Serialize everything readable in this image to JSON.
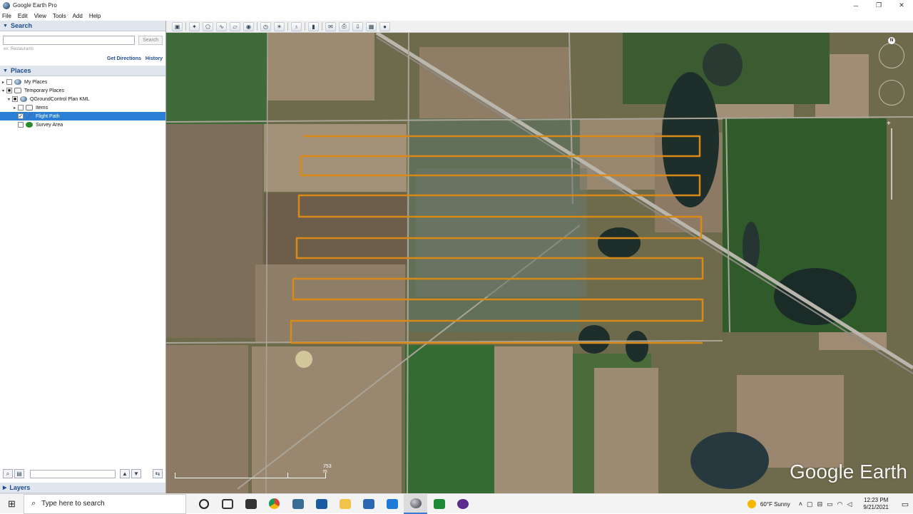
{
  "window": {
    "title": "Google Earth Pro",
    "controls": [
      "minimize-icon",
      "restore-icon",
      "close-icon"
    ]
  },
  "menu": [
    "File",
    "Edit",
    "View",
    "Tools",
    "Add",
    "Help"
  ],
  "search_panel": {
    "header": "Search",
    "input_value": "",
    "button": "Search",
    "hint": "ex: Restaurants",
    "get_directions": "Get Directions",
    "history": "History"
  },
  "places_panel": {
    "header": "Places",
    "items": [
      {
        "label": "My Places",
        "level": 0,
        "expander": "▸",
        "checked": false,
        "icon": "globe-icon"
      },
      {
        "label": "Temporary Places",
        "level": 0,
        "expander": "▾",
        "checked": true,
        "icon": "folder-icon"
      },
      {
        "label": "QGroundControl Plan KML",
        "level": 1,
        "expander": "▾",
        "checked": true,
        "icon": "globe-icon"
      },
      {
        "label": "Items",
        "level": 2,
        "expander": "▸",
        "checked": false,
        "icon": "folder-icon"
      },
      {
        "label": "Flight Path",
        "level": 2,
        "expander": "",
        "checked": true,
        "icon": "path-icon",
        "selected": true
      },
      {
        "label": "Survey Area",
        "level": 2,
        "expander": "",
        "checked": false,
        "icon": "polygon-icon"
      }
    ]
  },
  "layers_panel": {
    "header": "Layers"
  },
  "map": {
    "scale_label": "753 m",
    "brand": "Google Earth",
    "flight_path_color": "#d98a16",
    "compass_label": "N"
  },
  "taskbar": {
    "search_placeholder": "Type here to search",
    "weather": "60°F  Sunny",
    "time": "12:23 PM",
    "date": "9/21/2021"
  },
  "colors": {
    "selection": "#2a7fd4",
    "panel_header_text": "#1f4b8e",
    "taskbar_accent": "#3a7bd5"
  }
}
